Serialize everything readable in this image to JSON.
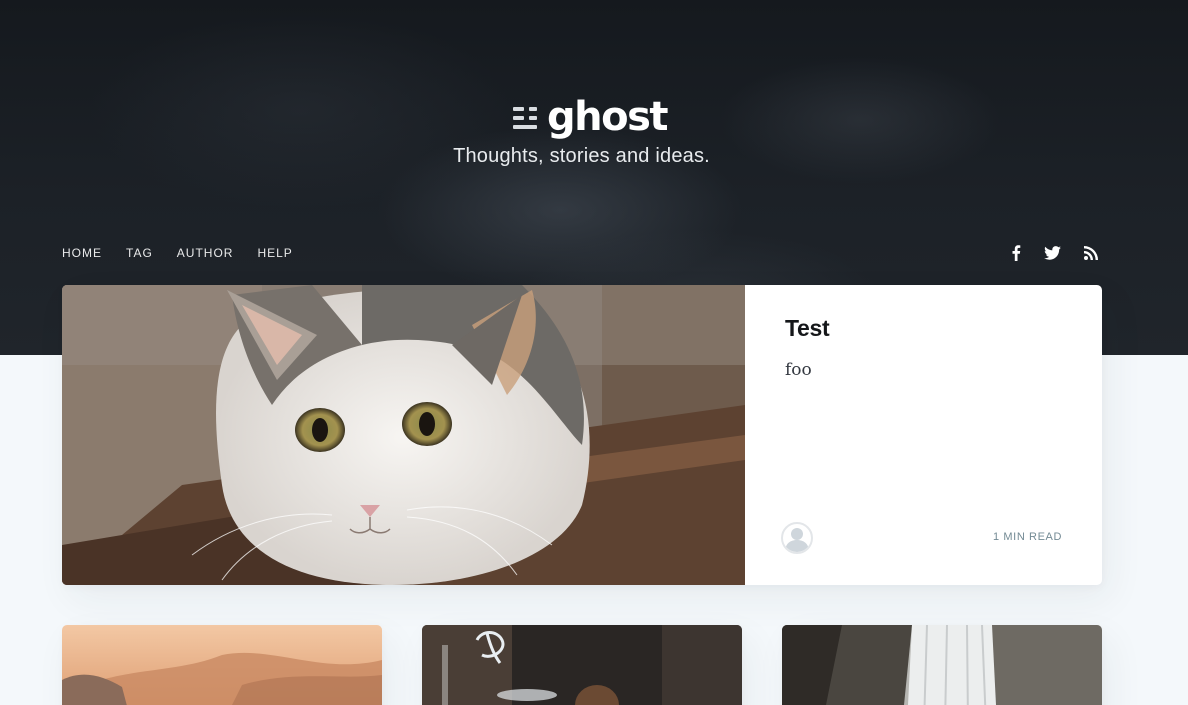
{
  "site": {
    "logo_text": "ghost",
    "tagline": "Thoughts, stories and ideas."
  },
  "nav": {
    "items": [
      {
        "label": "HOME"
      },
      {
        "label": "TAG"
      },
      {
        "label": "AUTHOR"
      },
      {
        "label": "HELP"
      }
    ]
  },
  "social": {
    "icons": [
      "facebook-icon",
      "twitter-icon",
      "rss-icon"
    ]
  },
  "featured_post": {
    "title": "Test",
    "excerpt": "foo",
    "reading_time": "1 MIN READ",
    "image": "cat photo",
    "author_avatar": "default-avatar"
  },
  "post_cards": [
    {
      "image": "mountain sunset photo"
    },
    {
      "image": "neon cafe photo"
    },
    {
      "image": "waterfall photo"
    }
  ],
  "colors": {
    "header_bg": "#1c2127",
    "page_bg": "#f4f8fb",
    "title": "#15171a",
    "meta": "#738a94"
  }
}
